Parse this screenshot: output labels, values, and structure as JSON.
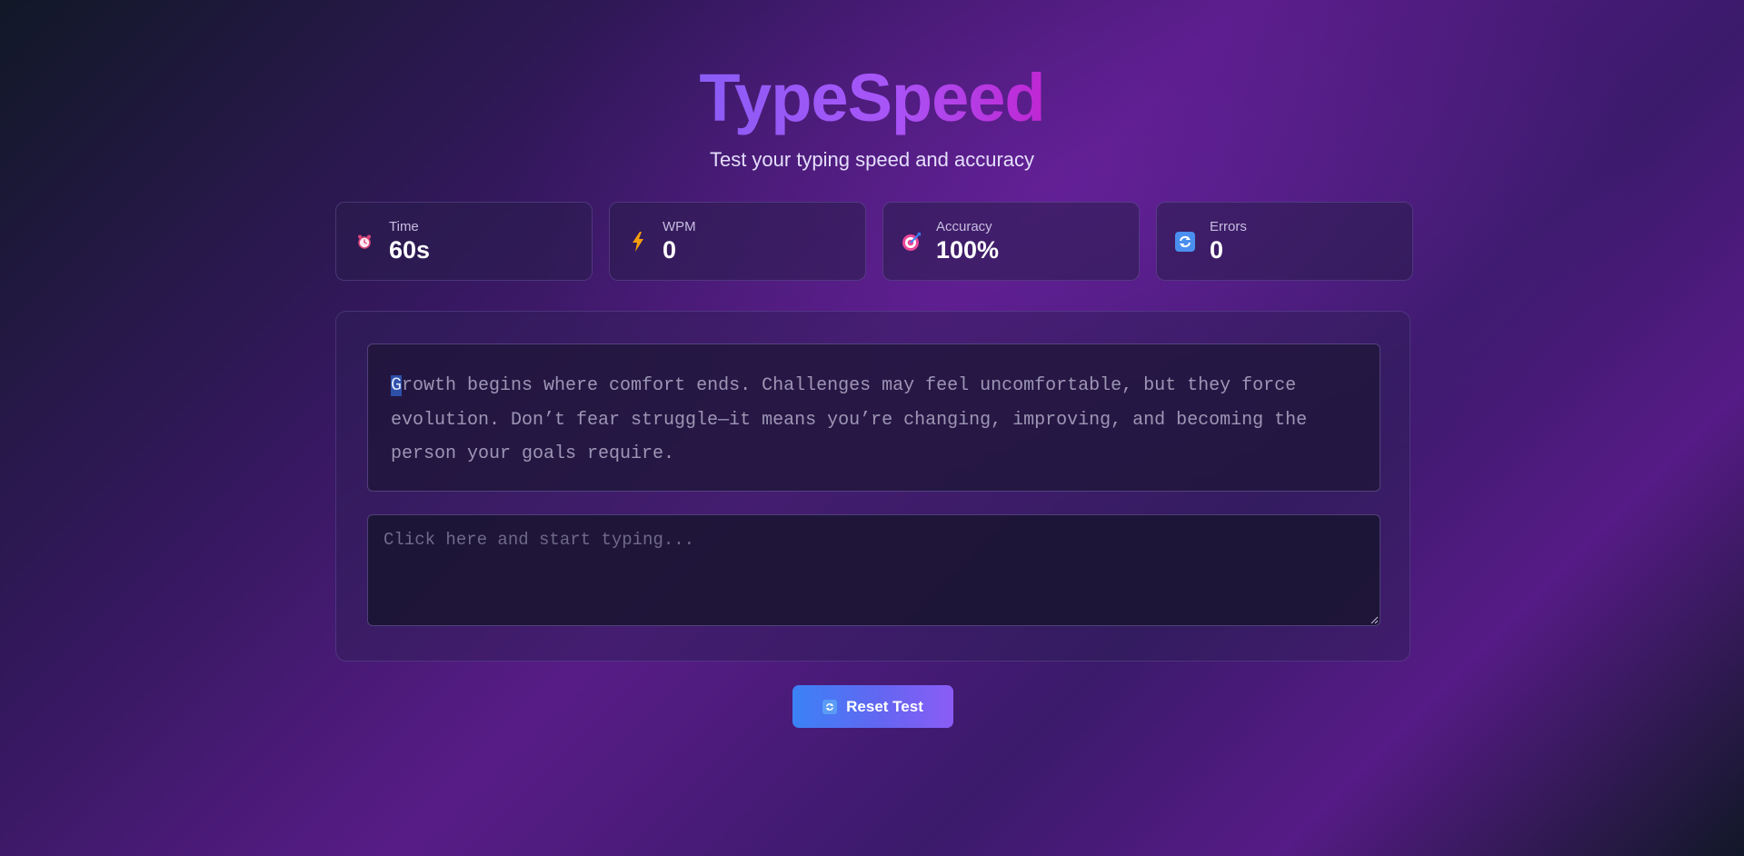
{
  "app": {
    "title": "TypeSpeed",
    "subtitle": "Test your typing speed and accuracy"
  },
  "stats": [
    {
      "label": "Time",
      "value": "60s",
      "icon": "alarm-clock-icon"
    },
    {
      "label": "WPM",
      "value": "0",
      "icon": "lightning-icon"
    },
    {
      "label": "Accuracy",
      "value": "100%",
      "icon": "target-icon"
    },
    {
      "label": "Errors",
      "value": "0",
      "icon": "refresh-icon"
    }
  ],
  "passage": {
    "current_char": "G",
    "rest": "rowth begins where comfort ends. Challenges may feel uncomfortable, but they force evolution. Don’t fear struggle—it means you’re changing, improving, and becoming the person your goals require."
  },
  "input": {
    "placeholder": "Click here and start typing...",
    "value": ""
  },
  "reset_button": {
    "label": "Reset Test",
    "icon": "refresh-icon"
  },
  "colors": {
    "accent_blue": "#3b82f6",
    "accent_purple": "#8b5cf6",
    "title_gradient_end": "#c026d3"
  }
}
